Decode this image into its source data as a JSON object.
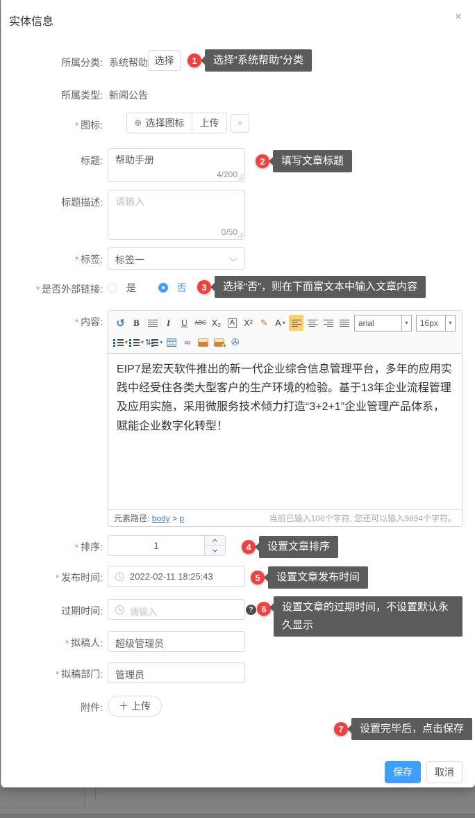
{
  "modal": {
    "title": "实体信息",
    "close_glyph": "×"
  },
  "form": {
    "category": {
      "label": "所属分类:",
      "value": "系统帮助",
      "button": "选择"
    },
    "type": {
      "label": "所属类型:",
      "value": "新闻公告"
    },
    "icon": {
      "required": "*",
      "label": "图标:",
      "plus_glyph": "⊕",
      "select_button": "选择图标",
      "upload_button": "上传",
      "clear_glyph": "×"
    },
    "title": {
      "label": "标题:",
      "value": "帮助手册",
      "counter": "4/200"
    },
    "description": {
      "label": "标题描述:",
      "placeholder": "请输入",
      "counter": "0/50"
    },
    "tag": {
      "required": "*",
      "label": "标签:",
      "value": "标签一"
    },
    "external_link": {
      "required": "*",
      "label": "是否外部链接:",
      "options": [
        {
          "label": "是"
        },
        {
          "label": "否"
        }
      ]
    },
    "content": {
      "required": "*",
      "label": "内容:"
    },
    "sort": {
      "required": "*",
      "label": "排序:",
      "value": "1"
    },
    "publish_time": {
      "required": "*",
      "label": "发布时间:",
      "value": "2022-02-11 18:25:43"
    },
    "expire_time": {
      "label": "过期时间:",
      "placeholder": "请输入",
      "help_glyph": "?"
    },
    "drafter": {
      "required": "*",
      "label": "拟稿人:",
      "value": "超级管理员"
    },
    "draft_dept": {
      "required": "*",
      "label": "拟稿部门:",
      "value": "管理员"
    },
    "attachment": {
      "label": "附件:",
      "upload_button": "＋ 上传"
    }
  },
  "editor": {
    "toolbar": {
      "undo": "↺",
      "bold": "B",
      "italic": "I",
      "underline": "U",
      "strike": "ABC",
      "subscript": "X₂",
      "fontbox": "A",
      "superscript": "X²",
      "painter": "✎",
      "fontcolor": "A",
      "caret": "▾",
      "font_family": "arial",
      "font_size": "16px",
      "lineheight": "⇅",
      "link": "∞",
      "attach": "✇"
    },
    "content_text": "EIP7是宏天软件推出的新一代企业综合信息管理平台，多年的应用实践中经受住各类大型客户的生产环境的检验。基于13年企业流程管理及应用实施，采用微服务技术倾力打造“3+2+1”企业管理产品体系，赋能企业数字化转型！",
    "path_label": "元素路径:",
    "path_sep": ">",
    "path_links": [
      "body",
      "p"
    ],
    "char_status": "当前已输入106个字符, 您还可以输入9894个字符。"
  },
  "annotations": [
    {
      "num": "1",
      "text": "选择“系统帮助”分类"
    },
    {
      "num": "2",
      "text": "填写文章标题"
    },
    {
      "num": "3",
      "text": "选择“否”，则在下面富文本中输入文章内容"
    },
    {
      "num": "4",
      "text": "设置文章排序"
    },
    {
      "num": "5",
      "text": "设置文章发布时间"
    },
    {
      "num": "6",
      "text": "设置文章的过期时间，不设置默认永久显示"
    },
    {
      "num": "7",
      "text": "设置完毕后，点击保存"
    }
  ],
  "footer": {
    "save": "保存",
    "cancel": "取消"
  },
  "colors": {
    "accent": "#409eff",
    "badge": "#f2413d",
    "tooltip_bg": "#5b5b5b"
  }
}
